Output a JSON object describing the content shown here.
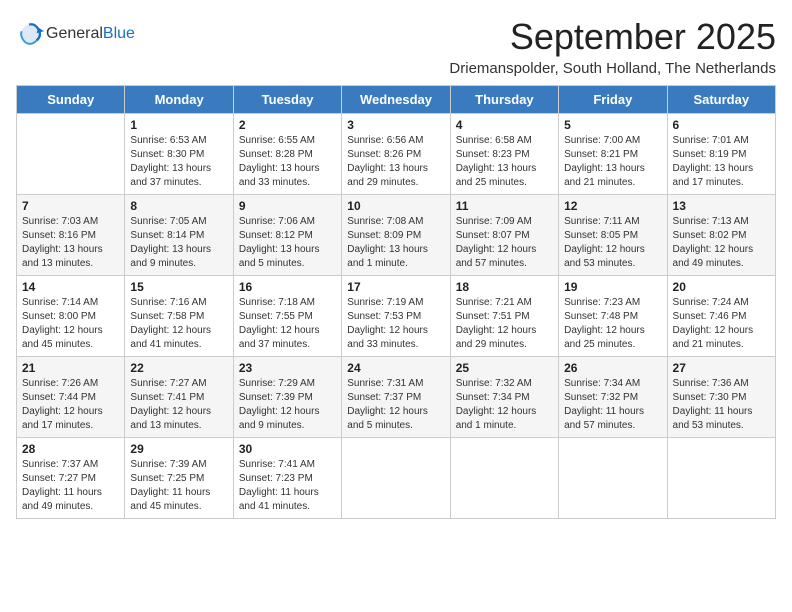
{
  "header": {
    "logo_line1": "General",
    "logo_line2": "Blue",
    "month_title": "September 2025",
    "location": "Driemanspolder, South Holland, The Netherlands"
  },
  "days_of_week": [
    "Sunday",
    "Monday",
    "Tuesday",
    "Wednesday",
    "Thursday",
    "Friday",
    "Saturday"
  ],
  "weeks": [
    [
      {
        "day": "",
        "info": ""
      },
      {
        "day": "1",
        "info": "Sunrise: 6:53 AM\nSunset: 8:30 PM\nDaylight: 13 hours\nand 37 minutes."
      },
      {
        "day": "2",
        "info": "Sunrise: 6:55 AM\nSunset: 8:28 PM\nDaylight: 13 hours\nand 33 minutes."
      },
      {
        "day": "3",
        "info": "Sunrise: 6:56 AM\nSunset: 8:26 PM\nDaylight: 13 hours\nand 29 minutes."
      },
      {
        "day": "4",
        "info": "Sunrise: 6:58 AM\nSunset: 8:23 PM\nDaylight: 13 hours\nand 25 minutes."
      },
      {
        "day": "5",
        "info": "Sunrise: 7:00 AM\nSunset: 8:21 PM\nDaylight: 13 hours\nand 21 minutes."
      },
      {
        "day": "6",
        "info": "Sunrise: 7:01 AM\nSunset: 8:19 PM\nDaylight: 13 hours\nand 17 minutes."
      }
    ],
    [
      {
        "day": "7",
        "info": "Sunrise: 7:03 AM\nSunset: 8:16 PM\nDaylight: 13 hours\nand 13 minutes."
      },
      {
        "day": "8",
        "info": "Sunrise: 7:05 AM\nSunset: 8:14 PM\nDaylight: 13 hours\nand 9 minutes."
      },
      {
        "day": "9",
        "info": "Sunrise: 7:06 AM\nSunset: 8:12 PM\nDaylight: 13 hours\nand 5 minutes."
      },
      {
        "day": "10",
        "info": "Sunrise: 7:08 AM\nSunset: 8:09 PM\nDaylight: 13 hours\nand 1 minute."
      },
      {
        "day": "11",
        "info": "Sunrise: 7:09 AM\nSunset: 8:07 PM\nDaylight: 12 hours\nand 57 minutes."
      },
      {
        "day": "12",
        "info": "Sunrise: 7:11 AM\nSunset: 8:05 PM\nDaylight: 12 hours\nand 53 minutes."
      },
      {
        "day": "13",
        "info": "Sunrise: 7:13 AM\nSunset: 8:02 PM\nDaylight: 12 hours\nand 49 minutes."
      }
    ],
    [
      {
        "day": "14",
        "info": "Sunrise: 7:14 AM\nSunset: 8:00 PM\nDaylight: 12 hours\nand 45 minutes."
      },
      {
        "day": "15",
        "info": "Sunrise: 7:16 AM\nSunset: 7:58 PM\nDaylight: 12 hours\nand 41 minutes."
      },
      {
        "day": "16",
        "info": "Sunrise: 7:18 AM\nSunset: 7:55 PM\nDaylight: 12 hours\nand 37 minutes."
      },
      {
        "day": "17",
        "info": "Sunrise: 7:19 AM\nSunset: 7:53 PM\nDaylight: 12 hours\nand 33 minutes."
      },
      {
        "day": "18",
        "info": "Sunrise: 7:21 AM\nSunset: 7:51 PM\nDaylight: 12 hours\nand 29 minutes."
      },
      {
        "day": "19",
        "info": "Sunrise: 7:23 AM\nSunset: 7:48 PM\nDaylight: 12 hours\nand 25 minutes."
      },
      {
        "day": "20",
        "info": "Sunrise: 7:24 AM\nSunset: 7:46 PM\nDaylight: 12 hours\nand 21 minutes."
      }
    ],
    [
      {
        "day": "21",
        "info": "Sunrise: 7:26 AM\nSunset: 7:44 PM\nDaylight: 12 hours\nand 17 minutes."
      },
      {
        "day": "22",
        "info": "Sunrise: 7:27 AM\nSunset: 7:41 PM\nDaylight: 12 hours\nand 13 minutes."
      },
      {
        "day": "23",
        "info": "Sunrise: 7:29 AM\nSunset: 7:39 PM\nDaylight: 12 hours\nand 9 minutes."
      },
      {
        "day": "24",
        "info": "Sunrise: 7:31 AM\nSunset: 7:37 PM\nDaylight: 12 hours\nand 5 minutes."
      },
      {
        "day": "25",
        "info": "Sunrise: 7:32 AM\nSunset: 7:34 PM\nDaylight: 12 hours\nand 1 minute."
      },
      {
        "day": "26",
        "info": "Sunrise: 7:34 AM\nSunset: 7:32 PM\nDaylight: 11 hours\nand 57 minutes."
      },
      {
        "day": "27",
        "info": "Sunrise: 7:36 AM\nSunset: 7:30 PM\nDaylight: 11 hours\nand 53 minutes."
      }
    ],
    [
      {
        "day": "28",
        "info": "Sunrise: 7:37 AM\nSunset: 7:27 PM\nDaylight: 11 hours\nand 49 minutes."
      },
      {
        "day": "29",
        "info": "Sunrise: 7:39 AM\nSunset: 7:25 PM\nDaylight: 11 hours\nand 45 minutes."
      },
      {
        "day": "30",
        "info": "Sunrise: 7:41 AM\nSunset: 7:23 PM\nDaylight: 11 hours\nand 41 minutes."
      },
      {
        "day": "",
        "info": ""
      },
      {
        "day": "",
        "info": ""
      },
      {
        "day": "",
        "info": ""
      },
      {
        "day": "",
        "info": ""
      }
    ]
  ]
}
